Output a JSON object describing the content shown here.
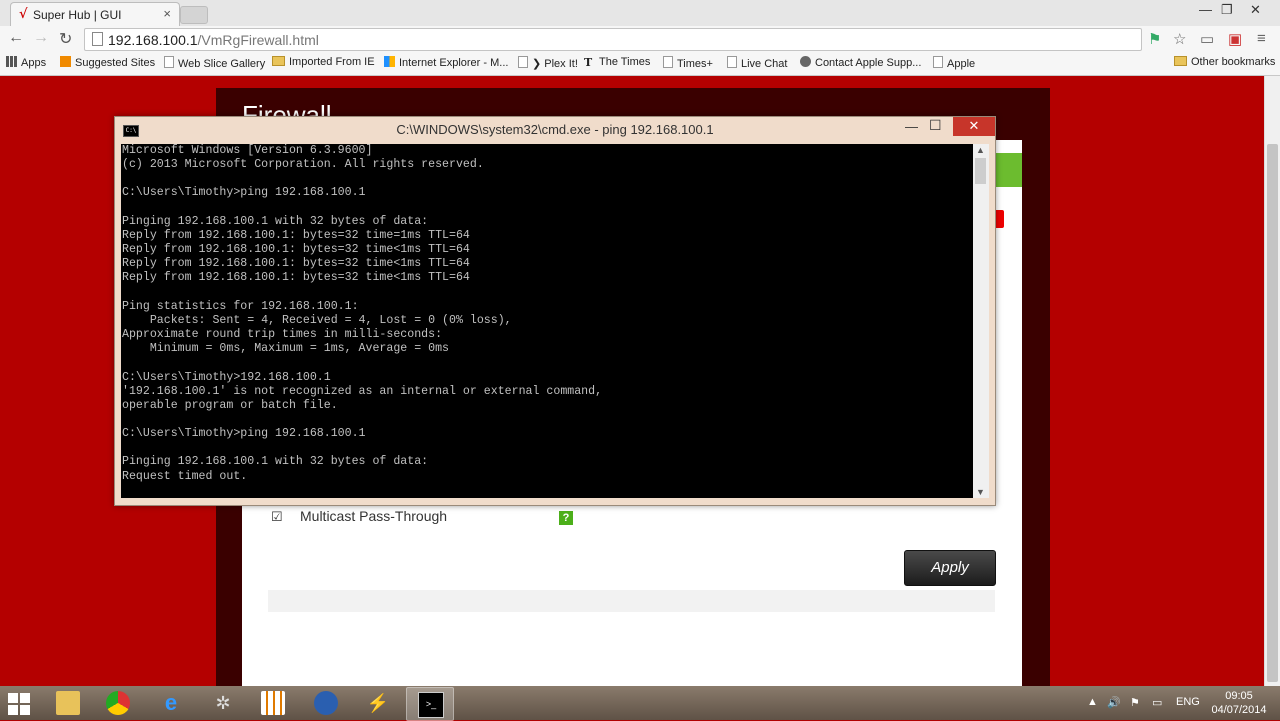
{
  "browser": {
    "tab_title": "Super Hub | GUI",
    "tab_favicon": "√",
    "tab_close": "×",
    "url_host": "192.168.100.1",
    "url_path": "/VmRgFirewall.html",
    "bookmarks": [
      {
        "label": "Apps",
        "icon": "apps-grid-icon"
      },
      {
        "label": "Suggested Sites",
        "icon": "suggested-sites-icon"
      },
      {
        "label": "Web Slice Gallery",
        "icon": "page-icon"
      },
      {
        "label": "Imported From IE",
        "icon": "folder-icon"
      },
      {
        "label": "Internet Explorer - M...",
        "icon": "windows-flag-icon"
      },
      {
        "label": "❯ Plex It!",
        "icon": "page-icon"
      },
      {
        "label": "The Times",
        "icon": "times-t-icon"
      },
      {
        "label": "Times+",
        "icon": "page-icon"
      },
      {
        "label": "Live Chat",
        "icon": "page-icon"
      },
      {
        "label": "Contact Apple Supp...",
        "icon": "apple-icon"
      },
      {
        "label": "Apple",
        "icon": "page-icon"
      }
    ],
    "other_bookmarks": "Other bookmarks"
  },
  "page": {
    "title_partial": "Firewall",
    "multicast_label": "Multicast Pass-Through",
    "multicast_checked": true,
    "help_label": "?",
    "apply_label": "Apply"
  },
  "cmd": {
    "title": "C:\\WINDOWS\\system32\\cmd.exe - ping  192.168.100.1",
    "icon_text": "C:\\",
    "close": "✕",
    "lines": [
      "Microsoft Windows [Version 6.3.9600]",
      "(c) 2013 Microsoft Corporation. All rights reserved.",
      "",
      "C:\\Users\\Timothy>ping 192.168.100.1",
      "",
      "Pinging 192.168.100.1 with 32 bytes of data:",
      "Reply from 192.168.100.1: bytes=32 time=1ms TTL=64",
      "Reply from 192.168.100.1: bytes=32 time<1ms TTL=64",
      "Reply from 192.168.100.1: bytes=32 time<1ms TTL=64",
      "Reply from 192.168.100.1: bytes=32 time<1ms TTL=64",
      "",
      "Ping statistics for 192.168.100.1:",
      "    Packets: Sent = 4, Received = 4, Lost = 0 (0% loss),",
      "Approximate round trip times in milli-seconds:",
      "    Minimum = 0ms, Maximum = 1ms, Average = 0ms",
      "",
      "C:\\Users\\Timothy>192.168.100.1",
      "'192.168.100.1' is not recognized as an internal or external command,",
      "operable program or batch file.",
      "",
      "C:\\Users\\Timothy>ping 192.168.100.1",
      "",
      "Pinging 192.168.100.1 with 32 bytes of data:",
      "Request timed out."
    ]
  },
  "taskbar": {
    "apps": [
      "file-explorer",
      "chrome",
      "internet-explorer",
      "network-tool",
      "store",
      "thunderbird",
      "winamp",
      "command-prompt"
    ],
    "language": "ENG",
    "time": "09:05",
    "date": "04/07/2014"
  },
  "colors": {
    "hub_red": "#b40000",
    "green_accent": "#6cbc2f",
    "cmd_background": "#000000",
    "cmd_text": "#c0c0c0"
  }
}
